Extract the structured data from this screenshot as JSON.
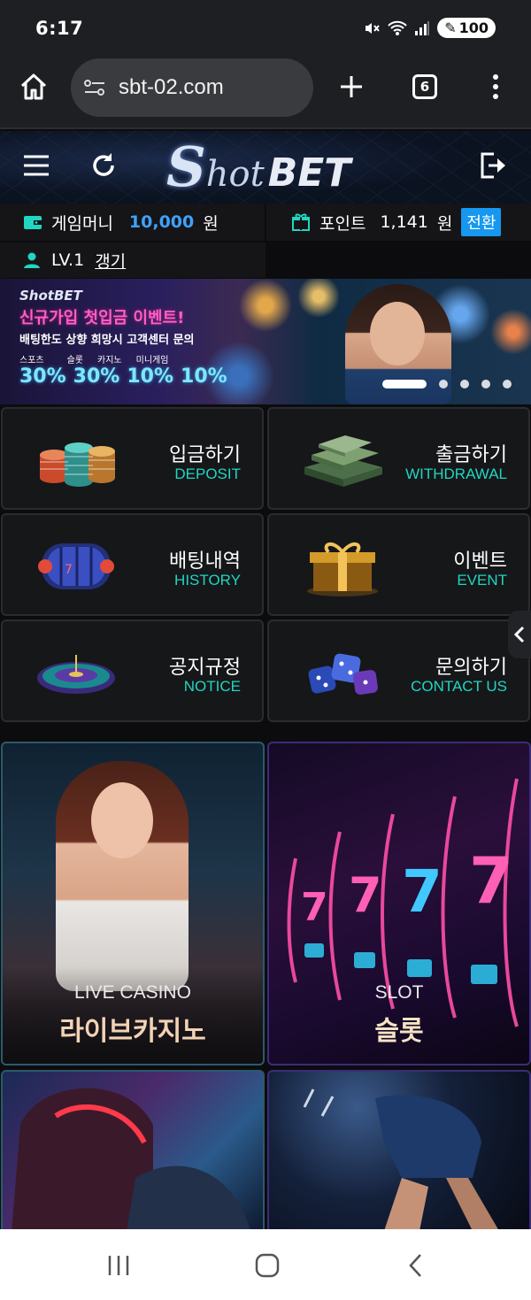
{
  "status_bar": {
    "time": "6:17",
    "battery": "100"
  },
  "browser": {
    "url": "sbt-02.com",
    "tab_count": "6"
  },
  "site": {
    "logo_s": "S",
    "logo_hot": "hot",
    "logo_bet": "BET"
  },
  "account": {
    "money_label": "게임머니",
    "money_value": "10,000",
    "money_unit": "원",
    "points_label": "포인트",
    "points_value": "1,141",
    "points_unit": "원",
    "convert_label": "전환",
    "level": "LV.1",
    "renew_label": "갱기"
  },
  "banner": {
    "logo_text": "ShotBET",
    "headline": "신규가입 첫입금 이벤트!",
    "subline": "배팅한도 상향 희망시 고객센터 문의",
    "categories": [
      "스포츠",
      "슬롯",
      "카지노",
      "미니게임"
    ],
    "percents": [
      "30%",
      "30%",
      "10%",
      "10%"
    ],
    "slides": 5,
    "active_slide": 1
  },
  "menu": [
    {
      "ko": "입금하기",
      "en": "DEPOSIT",
      "icon": "chips-icon"
    },
    {
      "ko": "출금하기",
      "en": "WITHDRAWAL",
      "icon": "cash-stack-icon"
    },
    {
      "ko": "배팅내역",
      "en": "HISTORY",
      "icon": "slot-reel-icon"
    },
    {
      "ko": "이벤트",
      "en": "EVENT",
      "icon": "gift-box-icon"
    },
    {
      "ko": "공지규정",
      "en": "NOTICE",
      "icon": "roulette-icon"
    },
    {
      "ko": "문의하기",
      "en": "CONTACT US",
      "icon": "dice-icon"
    }
  ],
  "games": [
    {
      "en": "LIVE CASINO",
      "ko": "라이브카지노"
    },
    {
      "en": "SLOT",
      "ko": "슬롯"
    }
  ],
  "colors": {
    "accent_teal": "#20d6c2",
    "accent_blue": "#1697f0",
    "money_blue": "#3ea2ff"
  }
}
